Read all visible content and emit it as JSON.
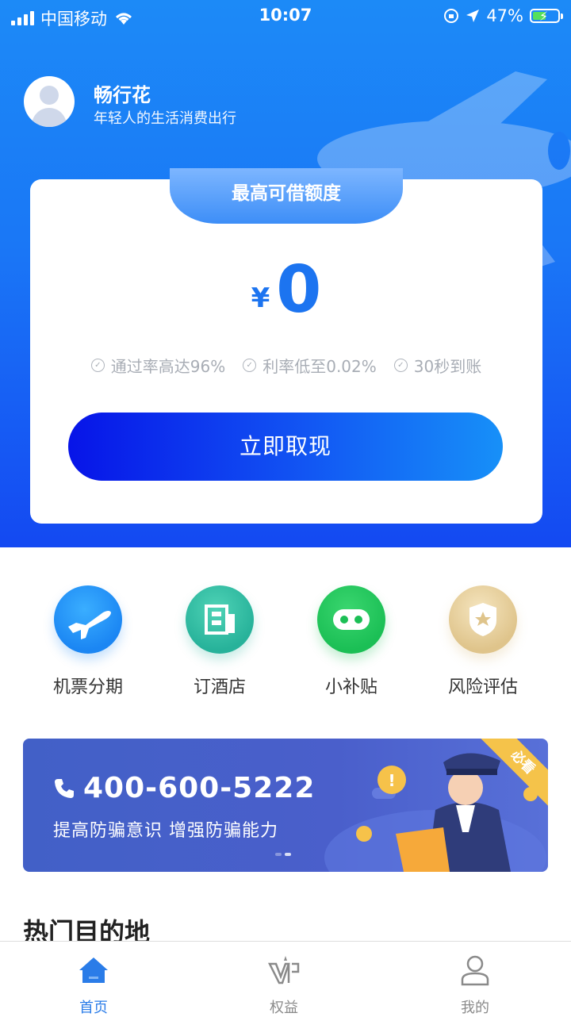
{
  "status_bar": {
    "carrier": "中国移动",
    "time": "10:07",
    "battery": "47%"
  },
  "user": {
    "name": "畅行花",
    "slogan": "年轻人的生活消费出行"
  },
  "credit_card": {
    "tab_title": "最高可借额度",
    "currency": "¥",
    "amount": "0",
    "features": [
      "通过率高达96%",
      "利率低至0.02%",
      "30秒到账"
    ],
    "cta_label": "立即取现"
  },
  "services": [
    {
      "label": "机票分期",
      "icon": "airplane-icon"
    },
    {
      "label": "订酒店",
      "icon": "hotel-icon"
    },
    {
      "label": "小补贴",
      "icon": "subsidy-icon"
    },
    {
      "label": "风险评估",
      "icon": "shield-star-icon"
    }
  ],
  "banner": {
    "phone": "400-600-5222",
    "slogan": "提高防骗意识  增强防骗能力",
    "corner_badge": "必看"
  },
  "section": {
    "title": "热门目的地"
  },
  "tabbar": {
    "items": [
      {
        "label": "首页",
        "icon": "home-icon",
        "active": true
      },
      {
        "label": "权益",
        "icon": "vip-icon",
        "active": false
      },
      {
        "label": "我的",
        "icon": "profile-icon",
        "active": false
      }
    ]
  },
  "colors": {
    "primary": "#1a77f6",
    "cta_start": "#0714e8",
    "cta_end": "#1790f8",
    "active_tab": "#2a7ce8",
    "banner_bg": "#4a5fcb"
  }
}
